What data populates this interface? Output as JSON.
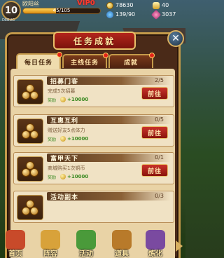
{
  "hud": {
    "level": "10",
    "player_name": "欧阳丝",
    "vip": "VIP0",
    "exp_text": "45/105",
    "exp_progress": 0.43,
    "debug": "DEBUG",
    "gold": "78630",
    "ingot": "40",
    "stamina": "139/90",
    "gems": "3037"
  },
  "panel": {
    "title": "任务成就",
    "close_icon": "close-icon"
  },
  "tabs": [
    {
      "label": "每日任务",
      "active": true,
      "alert": true
    },
    {
      "label": "主线任务",
      "active": false,
      "alert": true
    },
    {
      "label": "成就",
      "active": false,
      "alert": true
    }
  ],
  "tasks": [
    {
      "name": "招募门客",
      "progress": "2/5",
      "desc": "完成5次招募",
      "reward_label": "奖励",
      "reward_value": "+10000",
      "button": "前往"
    },
    {
      "name": "互惠互利",
      "progress": "0/5",
      "desc": "赠送好友5点体力",
      "reward_label": "奖励",
      "reward_value": "+10000",
      "button": "前往"
    },
    {
      "name": "富甲天下",
      "progress": "0/1",
      "desc": "商城购买1次铜币",
      "reward_label": "奖励",
      "reward_value": "+10000",
      "button": "前往"
    },
    {
      "name": "活动副本",
      "progress": "0/3",
      "desc": "",
      "reward_label": "",
      "reward_value": "",
      "button": ""
    }
  ],
  "bottom_nav": [
    {
      "label": "首页",
      "icon": "home-icon",
      "color": "#c84a2a"
    },
    {
      "label": "阵容",
      "icon": "lineup-icon",
      "color": "#d8a23a"
    },
    {
      "label": "活动",
      "icon": "activity-icon",
      "color": "#4a9a3a"
    },
    {
      "label": "道具",
      "icon": "item-bag-icon",
      "color": "#b87a2a"
    },
    {
      "label": "炼化",
      "icon": "refine-icon",
      "color": "#7a4aa0"
    }
  ]
}
